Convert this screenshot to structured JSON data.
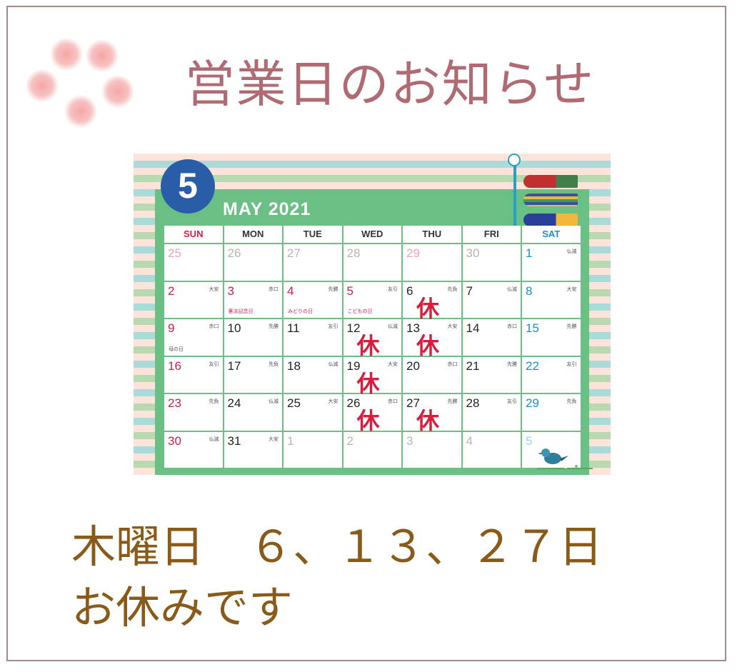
{
  "title": "営業日のお知らせ",
  "calendar": {
    "month_number": "5",
    "month_label": "MAY 2021",
    "weekdays": [
      "SUN",
      "MON",
      "TUE",
      "WED",
      "THU",
      "FRI",
      "SAT"
    ],
    "weeks": [
      [
        {
          "day": "25",
          "style": "pink"
        },
        {
          "day": "26",
          "style": "grey"
        },
        {
          "day": "27",
          "style": "grey"
        },
        {
          "day": "28",
          "style": "grey"
        },
        {
          "day": "29",
          "style": "pink"
        },
        {
          "day": "30",
          "style": "grey"
        },
        {
          "day": "1",
          "style": "blue",
          "rokuyo": "仏滅"
        }
      ],
      [
        {
          "day": "2",
          "style": "red",
          "rokuyo": "大安"
        },
        {
          "day": "3",
          "style": "red",
          "rokuyo": "赤口",
          "holiday": "憲法記念日"
        },
        {
          "day": "4",
          "style": "red",
          "rokuyo": "先勝",
          "holiday": "みどりの日"
        },
        {
          "day": "5",
          "style": "red",
          "rokuyo": "友引",
          "holiday": "こどもの日"
        },
        {
          "day": "6",
          "style": "black",
          "rokuyo": "先負",
          "closed": "休"
        },
        {
          "day": "7",
          "style": "black",
          "rokuyo": "仏滅"
        },
        {
          "day": "8",
          "style": "blue",
          "rokuyo": "大安"
        }
      ],
      [
        {
          "day": "9",
          "style": "red",
          "rokuyo": "赤口",
          "holiday": "母の日",
          "holiday_dark": true
        },
        {
          "day": "10",
          "style": "black",
          "rokuyo": "先勝"
        },
        {
          "day": "11",
          "style": "black",
          "rokuyo": "友引"
        },
        {
          "day": "12",
          "style": "black",
          "rokuyo": "仏滅",
          "closed": "休"
        },
        {
          "day": "13",
          "style": "black",
          "rokuyo": "大安",
          "closed": "休"
        },
        {
          "day": "14",
          "style": "black",
          "rokuyo": "赤口"
        },
        {
          "day": "15",
          "style": "blue",
          "rokuyo": "先勝"
        }
      ],
      [
        {
          "day": "16",
          "style": "red",
          "rokuyo": "友引"
        },
        {
          "day": "17",
          "style": "black",
          "rokuyo": "先負"
        },
        {
          "day": "18",
          "style": "black",
          "rokuyo": "仏滅"
        },
        {
          "day": "19",
          "style": "black",
          "rokuyo": "大安",
          "closed": "休"
        },
        {
          "day": "20",
          "style": "black",
          "rokuyo": "赤口"
        },
        {
          "day": "21",
          "style": "black",
          "rokuyo": "先勝"
        },
        {
          "day": "22",
          "style": "blue",
          "rokuyo": "友引"
        }
      ],
      [
        {
          "day": "23",
          "style": "red",
          "rokuyo": "先負"
        },
        {
          "day": "24",
          "style": "black",
          "rokuyo": "仏滅"
        },
        {
          "day": "25",
          "style": "black",
          "rokuyo": "大安"
        },
        {
          "day": "26",
          "style": "black",
          "rokuyo": "赤口",
          "closed": "休"
        },
        {
          "day": "27",
          "style": "black",
          "rokuyo": "先勝",
          "closed": "休"
        },
        {
          "day": "28",
          "style": "black",
          "rokuyo": "友引"
        },
        {
          "day": "29",
          "style": "blue",
          "rokuyo": "先負"
        }
      ],
      [
        {
          "day": "30",
          "style": "red",
          "rokuyo": "仏滅"
        },
        {
          "day": "31",
          "style": "black",
          "rokuyo": "大安"
        },
        {
          "day": "1",
          "style": "grey"
        },
        {
          "day": "2",
          "style": "grey"
        },
        {
          "day": "3",
          "style": "grey"
        },
        {
          "day": "4",
          "style": "grey"
        },
        {
          "day": "5",
          "style": "lightblue"
        }
      ]
    ],
    "decorations": [
      "koinobori-icon",
      "bird-icon",
      "cherry-blossom-icon"
    ]
  },
  "notice": {
    "line1": "木曜日　６、１３、２７日",
    "line2": "お休みです"
  },
  "colors": {
    "title": "#b06b72",
    "notice": "#8a5a18",
    "calendar_green": "#6abf85",
    "badge_blue": "#2a5da8",
    "closed_red": "#d81e3e"
  }
}
